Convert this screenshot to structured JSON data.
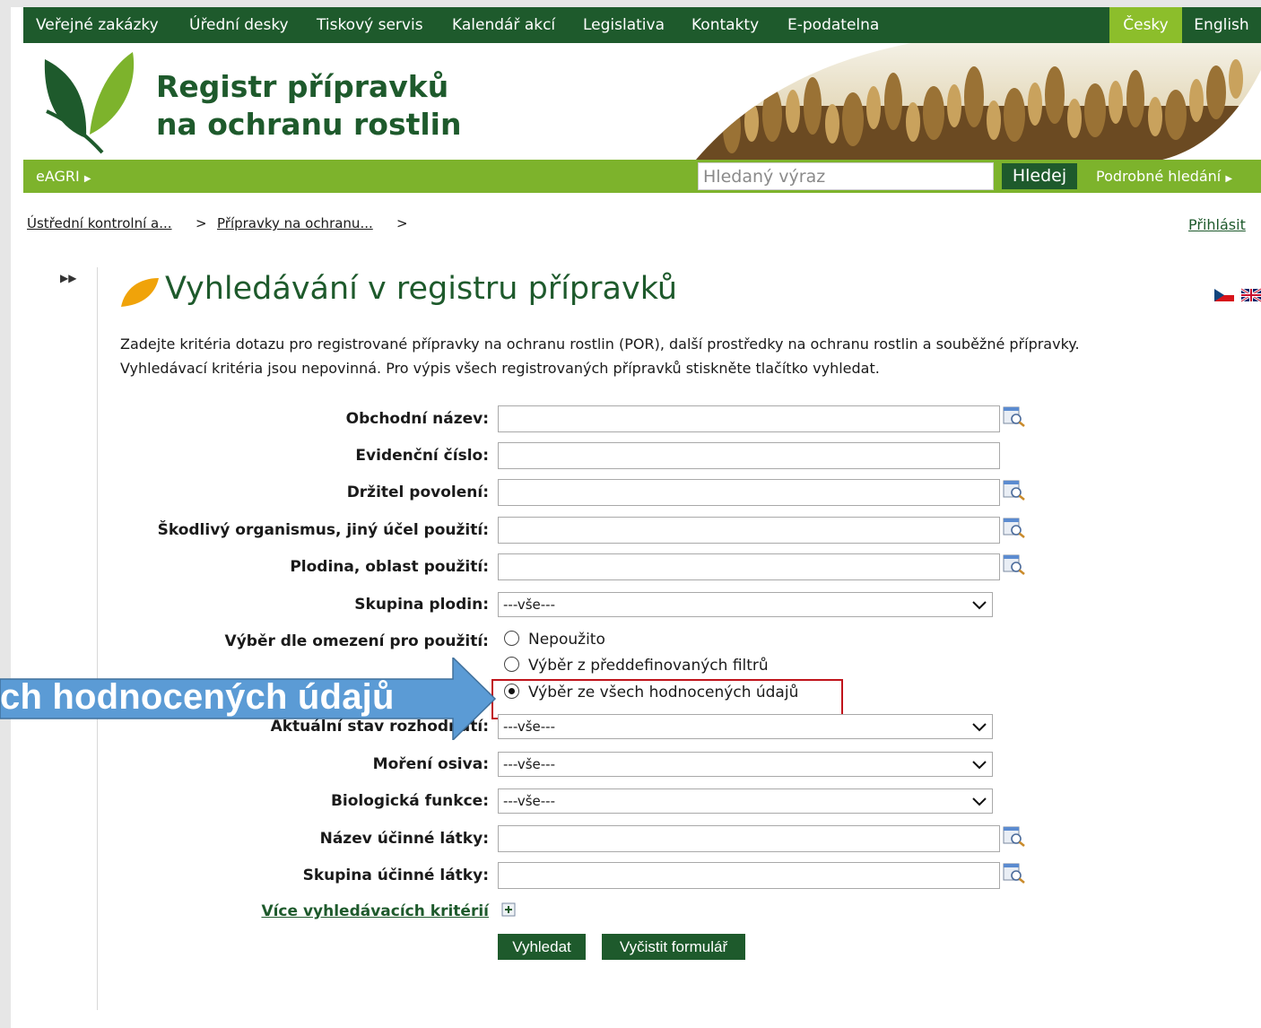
{
  "topnav": {
    "items": [
      "Veřejné zakázky",
      "Úřední desky",
      "Tiskový servis",
      "Kalendář akcí",
      "Legislativa",
      "Kontakty",
      "E-podatelna"
    ],
    "lang_cz": "Česky",
    "lang_en": "English"
  },
  "header": {
    "brand_line1": "Registr přípravků",
    "brand_line2": "na ochranu rostlin"
  },
  "greenbar": {
    "eagri": "eAGRI",
    "search_placeholder": "Hledaný výraz",
    "search_button": "Hledej",
    "advanced_search": "Podrobné hledání"
  },
  "breadcrumb": {
    "items": [
      "Ústřední kontrolní a...",
      "Přípravky na ochranu..."
    ],
    "separator": ">",
    "login": "Přihlásit"
  },
  "page": {
    "title": "Vyhledávání v registru přípravků",
    "intro_line1": "Zadejte kritéria dotazu pro registrované přípravky na ochranu rostlin (POR), další prostředky na ochranu rostlin a souběžné přípravky.",
    "intro_line2": "Vyhledávací kritéria jsou nepovinná. Pro výpis všech registrovaných přípravků stiskněte tlačítko vyhledat."
  },
  "form": {
    "trade_name_label": "Obchodní název:",
    "reg_number_label": "Evidenční číslo:",
    "holder_label": "Držitel povolení:",
    "pest_label": "Škodlivý organismus, jiný účel použití:",
    "crop_label": "Plodina, oblast použití:",
    "crop_group_label": "Skupina plodin:",
    "crop_group_value": "---vše---",
    "restriction_label": "Výběr dle omezení pro použití:",
    "restriction_options": [
      "Nepoužito",
      "Výběr z předdefinovaných filtrů",
      "Výběr ze všech hodnocených údajů"
    ],
    "restriction_selected": "Výběr ze všech hodnocených údajů",
    "decision_state_label": "Aktuální stav rozhodnutí:",
    "decision_state_value": "---vše---",
    "seed_treatment_label": "Moření osiva:",
    "seed_treatment_value": "---vše---",
    "bio_function_label": "Biologická funkce:",
    "bio_function_value": "---vše---",
    "active_name_label": "Název účinné látky:",
    "active_group_label": "Skupina účinné látky:",
    "more_criteria": "Více vyhledávacích kritérií",
    "search_button": "Vyhledat",
    "clear_button": "Vyčistit formulář"
  },
  "annotation": {
    "callout_text": "ch hodnocených údajů",
    "arrow_color": "#5b9bd5",
    "box_color": "#c0141b"
  },
  "colors": {
    "dark_green": "#1e5a2c",
    "light_green": "#7db32c",
    "lang_active": "#8cbe2b"
  }
}
